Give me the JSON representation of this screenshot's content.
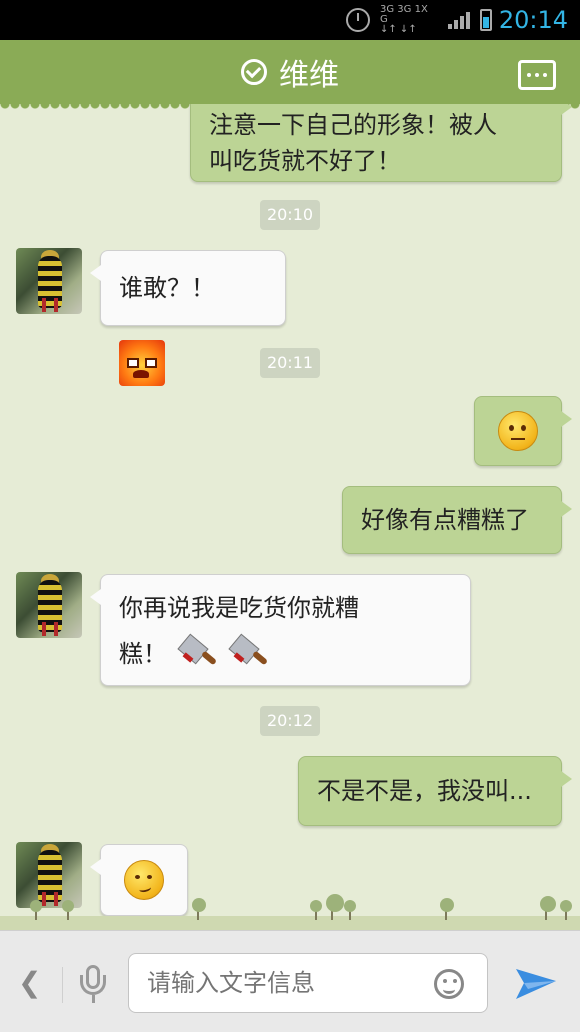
{
  "status_bar": {
    "time": "20:14",
    "network_label_top": "3G 3G 1X G",
    "network_label_bottom": "↓↑ ↓↑",
    "icons": [
      "alarm-icon",
      "signal-icon",
      "battery-icon"
    ]
  },
  "header": {
    "title": "维维",
    "status_icon": "check-circle-icon",
    "menu_icon": "more-icon"
  },
  "messages": [
    {
      "side": "right",
      "lines": [
        "注意一下自己的形象！被人",
        "叫吃货就不好了！"
      ]
    },
    {
      "type": "time",
      "text": "20:10"
    },
    {
      "side": "left",
      "text": "谁敢？！",
      "sticker": "angry-face-icon"
    },
    {
      "type": "time",
      "text": "20:11"
    },
    {
      "side": "right",
      "emoji": "worried-face-icon"
    },
    {
      "side": "right",
      "text": "好像有点糟糕了"
    },
    {
      "side": "left",
      "lines": [
        "你再说我是吃货你就糟",
        "糕！"
      ],
      "stickers": [
        "cleaver-icon",
        "cleaver-icon"
      ]
    },
    {
      "type": "time",
      "text": "20:12"
    },
    {
      "side": "right",
      "text": "不是不是，我没叫..."
    },
    {
      "side": "left",
      "emoji": "smirk-face-icon"
    }
  ],
  "input_bar": {
    "placeholder": "请输入文字信息",
    "back_icon": "chevron-left-icon",
    "mic_icon": "microphone-icon",
    "emoji_icon": "smiley-icon",
    "send_icon": "send-icon"
  },
  "colors": {
    "header": "#8aab56",
    "chat_background": "#e6ecd6",
    "outgoing_bubble": "#bcd495",
    "incoming_bubble": "#fafafa",
    "status_time": "#33b5e5",
    "send": "#3a8de0"
  }
}
